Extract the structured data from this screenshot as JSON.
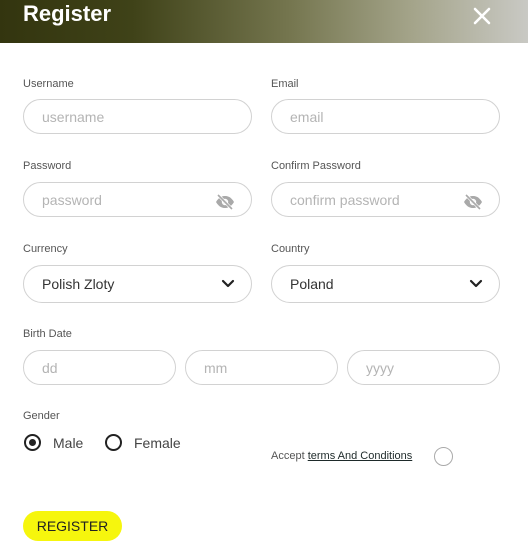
{
  "modal": {
    "title": "Register"
  },
  "colors": {
    "accent": "#f6f60d",
    "header_dark": "#33350f"
  },
  "fields": {
    "username": {
      "label": "Username",
      "placeholder": "username"
    },
    "email": {
      "label": "Email",
      "placeholder": "email"
    },
    "password": {
      "label": "Password",
      "placeholder": "password",
      "icon": "eye-off-icon"
    },
    "confirm_password": {
      "label": "Confirm Password",
      "placeholder": "confirm password",
      "icon": "eye-off-icon"
    },
    "currency": {
      "label": "Currency",
      "value": "Polish Zloty"
    },
    "country": {
      "label": "Country",
      "value": "Poland"
    },
    "birth_date": {
      "label": "Birth Date",
      "day_placeholder": "dd",
      "month_placeholder": "mm",
      "year_placeholder": "yyyy"
    }
  },
  "gender": {
    "label": "Gender",
    "options": [
      {
        "label": "Male",
        "checked": true
      },
      {
        "label": "Female",
        "checked": false
      }
    ]
  },
  "terms": {
    "prefix": "Accept",
    "link": "terms And Conditions",
    "accepted": false
  },
  "submit": {
    "label": "REGISTER"
  }
}
